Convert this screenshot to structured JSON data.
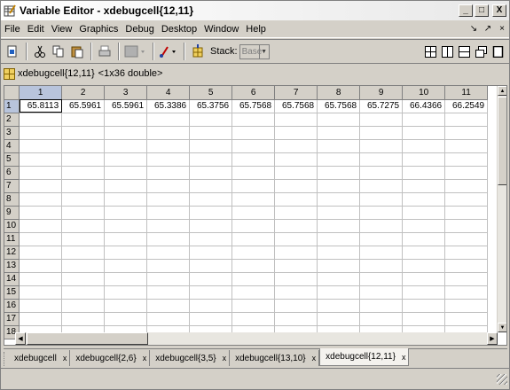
{
  "window": {
    "title": "Variable Editor - xdebugcell{12,11}",
    "minimize_label": "_",
    "restore_label": "□",
    "close_label": "X"
  },
  "menu": {
    "items": [
      "File",
      "Edit",
      "View",
      "Graphics",
      "Debug",
      "Desktop",
      "Window",
      "Help"
    ],
    "right_controls": [
      "↘",
      "↗",
      "×"
    ]
  },
  "toolbar": {
    "stack_label": "Stack:",
    "stack_value": "Base",
    "icons": [
      "import-icon",
      "cut-icon",
      "copy-icon",
      "paste-icon",
      "print-icon",
      "plot-selection-icon",
      "brush-icon",
      "new-variable-icon"
    ],
    "layout_icons": [
      "tile-icon",
      "left-right-icon",
      "top-bottom-icon",
      "float-icon",
      "maximize-icon"
    ]
  },
  "variable": {
    "name": "xdebugcell{12,11}",
    "info": "<1x36 double>"
  },
  "grid": {
    "columns": [
      "1",
      "2",
      "3",
      "4",
      "5",
      "6",
      "7",
      "8",
      "9",
      "10",
      "11"
    ],
    "rows": [
      "1",
      "2",
      "3",
      "4",
      "5",
      "6",
      "7",
      "8",
      "9",
      "10",
      "11",
      "12",
      "13",
      "14",
      "15",
      "16",
      "17",
      "18"
    ],
    "values": [
      "65.8113",
      "65.5961",
      "65.5961",
      "65.3386",
      "65.3756",
      "65.7568",
      "65.7568",
      "65.7568",
      "65.7275",
      "66.4366",
      "66.2549"
    ]
  },
  "doc_tabs": [
    {
      "label": "xdebugcell",
      "active": false
    },
    {
      "label": "xdebugcell{2,6}",
      "active": false
    },
    {
      "label": "xdebugcell{3,5}",
      "active": false
    },
    {
      "label": "xdebugcell{13,10}",
      "active": false
    },
    {
      "label": "xdebugcell{12,11}",
      "active": true
    }
  ],
  "close_glyph": "x"
}
